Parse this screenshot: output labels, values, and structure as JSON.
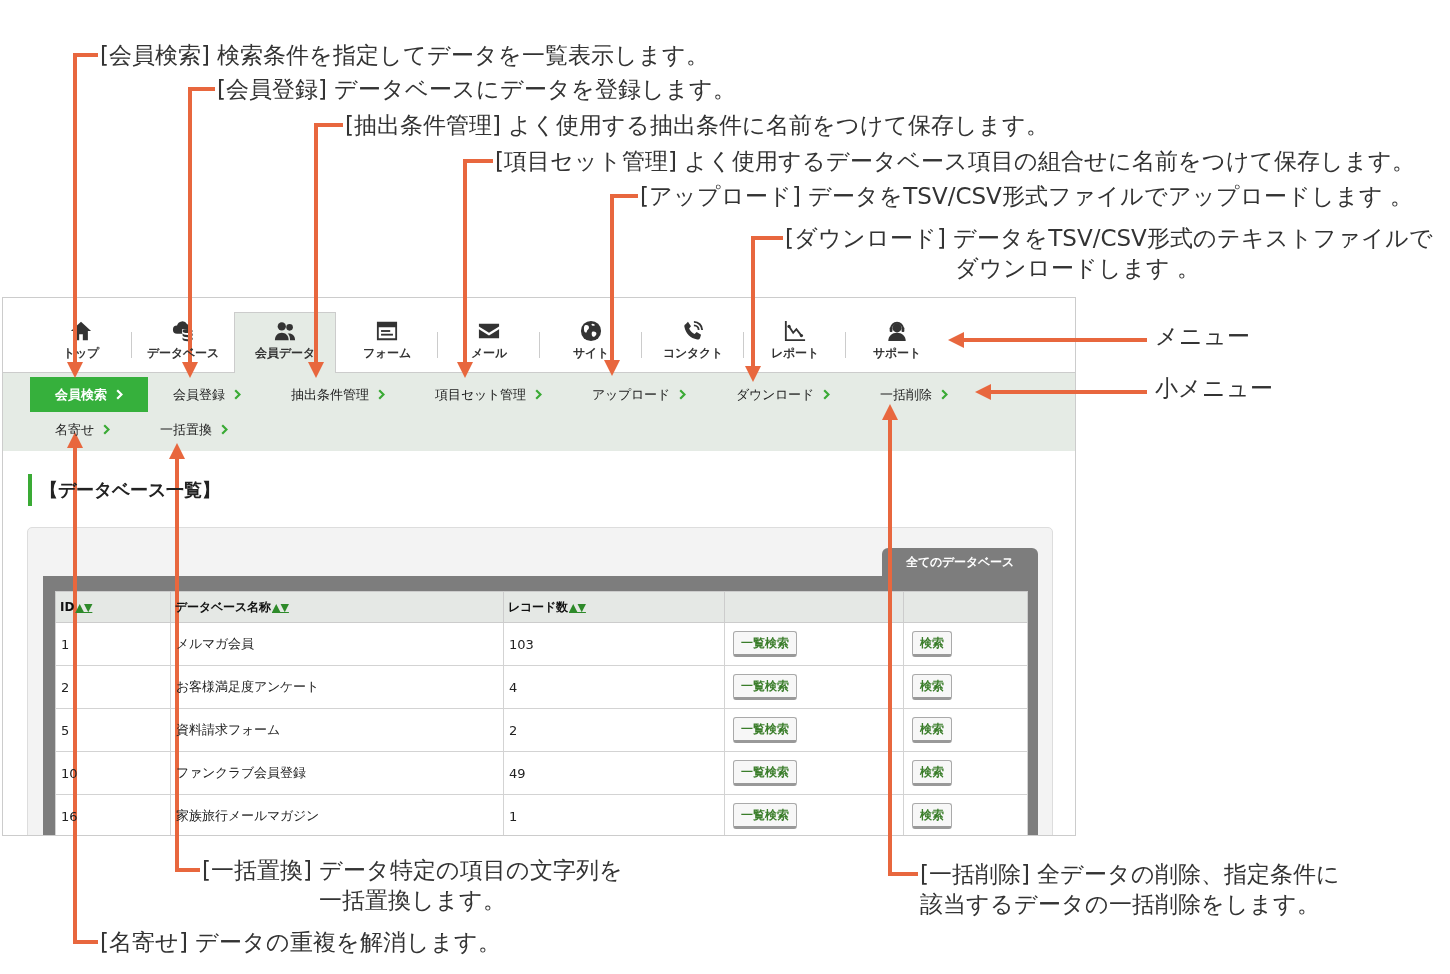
{
  "callouts": [
    {
      "lines": [
        "[会員検索] 検索条件を指定してデータを一覧表示します。"
      ]
    },
    {
      "lines": [
        "[会員登録] データベースにデータを登録します。"
      ]
    },
    {
      "lines": [
        "[抽出条件管理] よく使用する抽出条件に名前をつけて保存します。"
      ]
    },
    {
      "lines": [
        "[項目セット管理] よく使用するデータベース項目の組合せに名前をつけて保存します。"
      ]
    },
    {
      "lines": [
        "[アップロード] データをTSV/CSV形式ファイルでアップロードします 。"
      ]
    },
    {
      "lines": [
        "[ダウンロード] データをTSV/CSV形式のテキストファイルで",
        "ダウンロードします 。"
      ]
    },
    {
      "lines": [
        "メニュー"
      ]
    },
    {
      "lines": [
        "小メニュー"
      ]
    },
    {
      "lines": [
        "[一括置換] データ特定の項目の文字列を",
        "一括置換します。"
      ]
    },
    {
      "lines": [
        "[一括削除] 全データの削除、指定条件に",
        "該当するデータの一括削除をします。"
      ]
    },
    {
      "lines": [
        "[名寄せ] データの重複を解消します。"
      ]
    }
  ],
  "screen": {
    "menu": {
      "items": [
        {
          "label": "トップ",
          "selected": false
        },
        {
          "label": "データベース",
          "selected": false
        },
        {
          "label": "会員データ",
          "selected": true
        },
        {
          "label": "フォーム",
          "selected": false
        },
        {
          "label": "メール",
          "selected": false
        },
        {
          "label": "サイト",
          "selected": false
        },
        {
          "label": "コンタクト",
          "selected": false
        },
        {
          "label": "レポート",
          "selected": false
        },
        {
          "label": "サポート",
          "selected": false
        }
      ]
    },
    "submenu": {
      "rows": [
        [
          {
            "label": "会員検索",
            "selected": true
          },
          {
            "label": "会員登録",
            "selected": false
          },
          {
            "label": "抽出条件管理",
            "selected": false
          },
          {
            "label": "項目セット管理",
            "selected": false
          },
          {
            "label": "アップロード",
            "selected": false
          },
          {
            "label": "ダウンロード",
            "selected": false
          },
          {
            "label": "一括削除",
            "selected": false
          }
        ],
        [
          {
            "label": "名寄せ",
            "selected": false
          },
          {
            "label": "一括置換",
            "selected": false
          }
        ]
      ]
    },
    "heading": "【データベース一覧】",
    "database_list": {
      "tab": "全てのデータベース",
      "columns": [
        {
          "label": "ID",
          "sort": "▲▼"
        },
        {
          "label": "データベース名称",
          "sort": "▲▼"
        },
        {
          "label": "レコード数",
          "sort": "▲▼"
        }
      ],
      "rows": [
        {
          "cells": [
            "1",
            "メルマガ会員",
            "103"
          ],
          "actions": [
            "一覧検索",
            "検索"
          ]
        },
        {
          "cells": [
            "2",
            "お客様満足度アンケート",
            "4"
          ],
          "actions": [
            "一覧検索",
            "検索"
          ]
        },
        {
          "cells": [
            "5",
            "資料請求フォーム",
            "2"
          ],
          "actions": [
            "一覧検索",
            "検索"
          ]
        },
        {
          "cells": [
            "10",
            "ファンクラブ会員登録",
            "49"
          ],
          "actions": [
            "一覧検索",
            "検索"
          ]
        },
        {
          "cells": [
            "16",
            "家族旅行メールマガジン",
            "1"
          ],
          "actions": [
            "一覧検索",
            "検索"
          ]
        }
      ]
    }
  }
}
